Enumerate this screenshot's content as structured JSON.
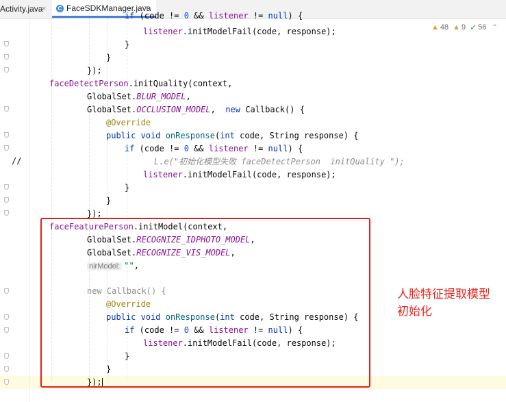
{
  "tabs": [
    {
      "label": "Activity.java",
      "close": "×"
    },
    {
      "label": "FaceSDKManager.java",
      "close": "×",
      "icon_letter": "C"
    }
  ],
  "inspections": {
    "warnings": "48",
    "weak_warnings": "9",
    "typos": "56"
  },
  "comment_marker": "//",
  "hint_label": "nirModel:",
  "annotation_note": [
    "人脸特征提取模型",
    "初始化"
  ],
  "colors": {
    "keyword": "#0033b3",
    "field": "#871094",
    "string": "#067d17",
    "number": "#1750eb",
    "annotation": "#9e880d",
    "highlight_box": "#e0201b"
  }
}
